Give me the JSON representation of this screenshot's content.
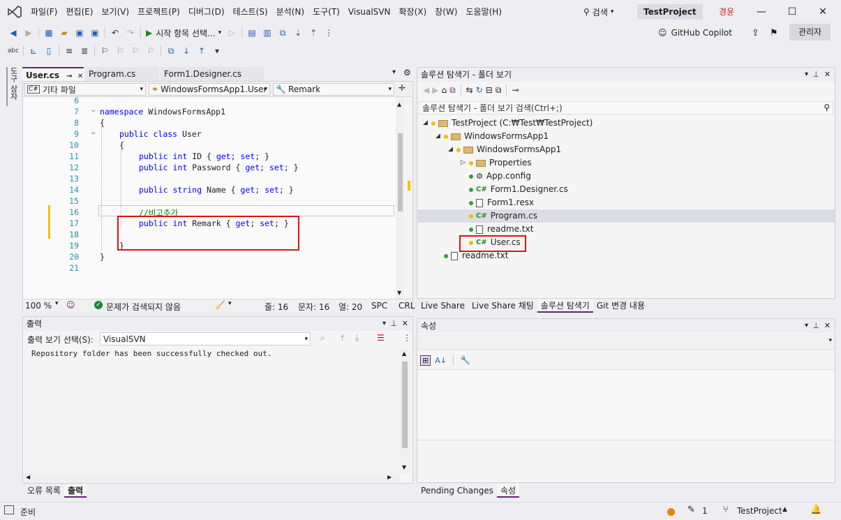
{
  "menu": [
    "파일(F)",
    "편집(E)",
    "보기(V)",
    "프로젝트(P)",
    "디버그(D)",
    "테스트(S)",
    "분석(N)",
    "도구(T)",
    "VisualSVN",
    "확장(X)",
    "창(W)",
    "도움말(H)"
  ],
  "search_label": "검색",
  "project_badge": "TestProject",
  "account": "경윤",
  "toolbar": {
    "start_label": "시작 항목 선택...",
    "copilot": "GitHub Copilot",
    "admin": "관리자"
  },
  "left_tab": "도구 상자",
  "editor": {
    "tabs": [
      "User.cs",
      "Program.cs",
      "Form1.Designer.cs"
    ],
    "nav": {
      "project": "기타 파일",
      "class": "WindowsFormsApp1.User",
      "member": "Remark"
    },
    "lines": [
      {
        "n": "6",
        "code": ""
      },
      {
        "n": "7",
        "code": "namespace WindowsFormsApp1"
      },
      {
        "n": "8",
        "code": "{"
      },
      {
        "n": "9",
        "code": "public class User"
      },
      {
        "n": "10",
        "code": "{"
      },
      {
        "n": "11",
        "code": "public int ID { get; set; }"
      },
      {
        "n": "12",
        "code": "public int Password { get; set; }"
      },
      {
        "n": "13",
        "code": ""
      },
      {
        "n": "14",
        "code": "public string Name { get; set; }"
      },
      {
        "n": "15",
        "code": ""
      },
      {
        "n": "16",
        "code": "//비고추가"
      },
      {
        "n": "17",
        "code": "public int Remark { get; set; }"
      },
      {
        "n": "18",
        "code": ""
      },
      {
        "n": "19",
        "code": "}"
      },
      {
        "n": "20",
        "code": "}"
      },
      {
        "n": "21",
        "code": ""
      }
    ],
    "status": {
      "zoom": "100 %",
      "issues": "문제가 검색되지 않음",
      "line": "줄: 16",
      "char": "문자: 16",
      "col": "열: 20",
      "spc": "SPC",
      "crlf": "CRL"
    }
  },
  "output": {
    "title": "출력",
    "source_label": "출력 보기 선택(S):",
    "source_value": "VisualSVN",
    "text": "Repository folder has been successfully checked out.",
    "bottom_tabs": [
      "오류 목록",
      "출력"
    ]
  },
  "solution": {
    "title": "솔루션 탐색기 - 폴더 보기",
    "search_placeholder": "솔루션 탐색기 - 폴더 보기 검색(Ctrl+;)",
    "tree": [
      {
        "label": "TestProject (C:₩Test₩TestProject)",
        "level": 0,
        "type": "folder",
        "arrow": "◢"
      },
      {
        "label": "WindowsFormsApp1",
        "level": 1,
        "type": "folder",
        "arrow": "◢"
      },
      {
        "label": "WindowsFormsApp1",
        "level": 2,
        "type": "folder",
        "arrow": "◢"
      },
      {
        "label": "Properties",
        "level": 3,
        "type": "folder",
        "arrow": "▷"
      },
      {
        "label": "App.config",
        "level": 3,
        "type": "config",
        "arrow": ""
      },
      {
        "label": "Form1.Designer.cs",
        "level": 3,
        "type": "cs",
        "arrow": ""
      },
      {
        "label": "Form1.resx",
        "level": 3,
        "type": "file",
        "arrow": ""
      },
      {
        "label": "Program.cs",
        "level": 3,
        "type": "cs",
        "arrow": ""
      },
      {
        "label": "readme.txt",
        "level": 3,
        "type": "file",
        "arrow": ""
      },
      {
        "label": "User.cs",
        "level": 3,
        "type": "cs",
        "arrow": ""
      },
      {
        "label": "readme.txt",
        "level": 1,
        "type": "file",
        "arrow": ""
      }
    ],
    "bottom_tabs": [
      "Live Share",
      "Live Share 채팅",
      "솔루션 탐색기",
      "Git 변경 내용"
    ]
  },
  "properties": {
    "title": "속성",
    "bottom_tabs": [
      "Pending Changes",
      "속성"
    ]
  },
  "statusbar": {
    "ready": "준비",
    "pending": "1",
    "repo": "TestProject"
  },
  "colors": {
    "accent": "#68217a",
    "highlight": "#e01010",
    "changed": "#f0c000"
  }
}
